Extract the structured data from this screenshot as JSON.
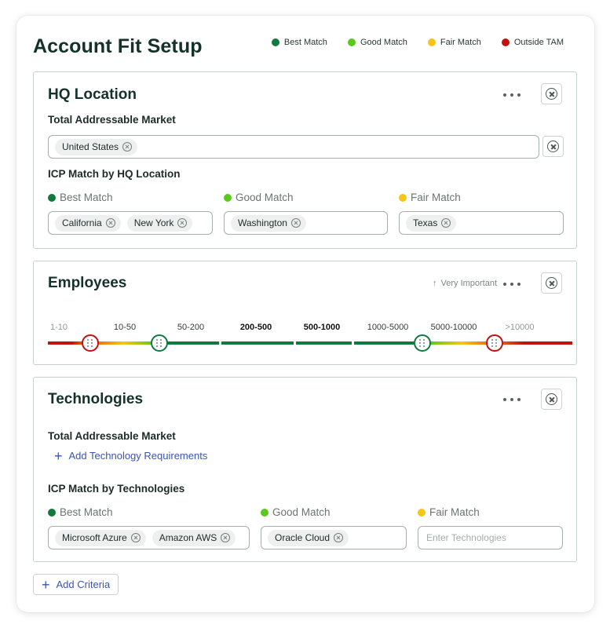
{
  "page": {
    "title": "Account Fit Setup",
    "legend": [
      {
        "label": "Best Match",
        "color": "#0f7a3c"
      },
      {
        "label": "Good Match",
        "color": "#5ac91c"
      },
      {
        "label": "Fair Match",
        "color": "#f5c518"
      },
      {
        "label": "Outside TAM",
        "color": "#c0130f"
      }
    ]
  },
  "hq": {
    "title": "HQ Location",
    "tam_label": "Total Addressable Market",
    "tam_chips": [
      "United States"
    ],
    "icp_label": "ICP Match by HQ Location",
    "groups": [
      {
        "label": "Best Match",
        "color": "#0f7a3c",
        "chips": [
          "California",
          "New York"
        ]
      },
      {
        "label": "Good Match",
        "color": "#5ac91c",
        "chips": [
          "Washington"
        ]
      },
      {
        "label": "Fair Match",
        "color": "#f5c518",
        "chips": [
          "Texas"
        ]
      }
    ]
  },
  "employees": {
    "title": "Employees",
    "importance": "Very Important",
    "importance_icon": "arrow-up-icon",
    "ranges": [
      "1-10",
      "10-50",
      "50-200",
      "200-500",
      "500-1000",
      "1000-5000",
      "5000-10000",
      ">10000"
    ]
  },
  "tech": {
    "title": "Technologies",
    "tam_label": "Total Addressable Market",
    "add_link": "Add Technology Requirements",
    "icp_label": "ICP Match by Technologies",
    "groups": [
      {
        "label": "Best Match",
        "color": "#0f7a3c",
        "chips": [
          "Microsoft Azure",
          "Amazon AWS"
        ]
      },
      {
        "label": "Good Match",
        "color": "#5ac91c",
        "chips": [
          "Oracle Cloud"
        ]
      },
      {
        "label": "Fair Match",
        "color": "#f5c518",
        "chips": [],
        "placeholder": "Enter Technologies"
      }
    ]
  },
  "add_criteria": "Add Criteria"
}
